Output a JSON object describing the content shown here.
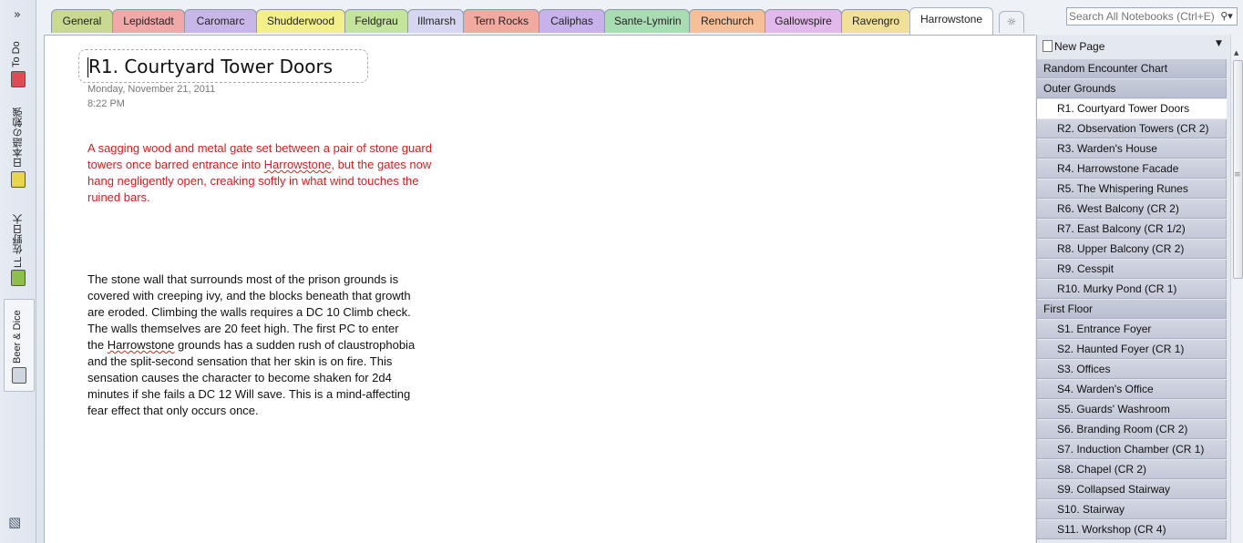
{
  "notebooks": [
    {
      "label": "To Do",
      "color": "#e04a54"
    },
    {
      "label": "日本語の勉強",
      "color": "#e9d54c"
    },
    {
      "label": "LL 佐野日大",
      "color": "#8cc04b"
    },
    {
      "label": "Beer & Dice",
      "color": "#cfd6df"
    }
  ],
  "search": {
    "placeholder": "Search All Notebooks (Ctrl+E)"
  },
  "tabs": [
    {
      "label": "General",
      "color": "#c9d98f"
    },
    {
      "label": "Lepidstadt",
      "color": "#f0a8a8"
    },
    {
      "label": "Caromarc",
      "color": "#c9b6e8"
    },
    {
      "label": "Shudderwood",
      "color": "#f3f08c"
    },
    {
      "label": "Feldgrau",
      "color": "#c4e39b"
    },
    {
      "label": "Illmarsh",
      "color": "#d6d6f0"
    },
    {
      "label": "Tern Rocks",
      "color": "#f2a9a0"
    },
    {
      "label": "Caliphas",
      "color": "#c7b3ea"
    },
    {
      "label": "Sante-Lymirin",
      "color": "#a9dcb2"
    },
    {
      "label": "Renchurch",
      "color": "#f7bf98"
    },
    {
      "label": "Gallowspire",
      "color": "#e2b9ea"
    },
    {
      "label": "Ravengro",
      "color": "#f1e198"
    },
    {
      "label": "Harrowstone",
      "color": "#ffffff"
    }
  ],
  "page": {
    "title": "R1. Courtyard Tower Doors",
    "date": "Monday, November  21, 2011",
    "time": "8:22 PM",
    "note1_a": "A sagging wood and metal gate set between a pair of stone guard towers once barred entrance into ",
    "note1_link": "Harrowstone",
    "note1_b": ", but the gates now hang negligently open, creaking softly in what wind touches the ruined bars.",
    "note2_a": "The stone wall that surrounds most of the prison grounds is covered with creeping ivy, and the blocks beneath that growth are eroded. Climbing the walls requires a DC 10 Climb check. The walls themselves are 20 feet high. The first PC to enter the ",
    "note2_link": "Harrowstone",
    "note2_b": " grounds has a sudden rush of claustrophobia and the split-second sensation that her skin is on fire. This sensation causes the character to become shaken for 2d4 minutes if she fails a DC 12 Will save. This is a mind-affecting fear effect that only occurs once."
  },
  "pane": {
    "new_page": "New Page",
    "pages": [
      {
        "label": "Random Encounter Chart",
        "kind": "sec"
      },
      {
        "label": "Outer Grounds",
        "kind": "sec"
      },
      {
        "label": "R1. Courtyard Tower Doors",
        "kind": "sel"
      },
      {
        "label": "R2. Observation Towers (CR 2)",
        "kind": "sub"
      },
      {
        "label": "R3. Warden's House",
        "kind": "sub"
      },
      {
        "label": "R4. Harrowstone Facade",
        "kind": "sub"
      },
      {
        "label": "R5. The Whispering Runes",
        "kind": "sub"
      },
      {
        "label": "R6. West Balcony (CR 2)",
        "kind": "sub"
      },
      {
        "label": "R7. East Balcony (CR 1/2)",
        "kind": "sub"
      },
      {
        "label": "R8. Upper Balcony (CR 2)",
        "kind": "sub"
      },
      {
        "label": "R9. Cesspit",
        "kind": "sub"
      },
      {
        "label": "R10. Murky Pond (CR 1)",
        "kind": "sub"
      },
      {
        "label": "First Floor",
        "kind": "sec"
      },
      {
        "label": "S1. Entrance Foyer",
        "kind": "sub"
      },
      {
        "label": "S2. Haunted Foyer (CR 1)",
        "kind": "sub"
      },
      {
        "label": "S3. Offices",
        "kind": "sub"
      },
      {
        "label": "S4. Warden's Office",
        "kind": "sub"
      },
      {
        "label": "S5. Guards' Washroom",
        "kind": "sub"
      },
      {
        "label": "S6. Branding Room (CR 2)",
        "kind": "sub"
      },
      {
        "label": "S7. Induction Chamber (CR 1)",
        "kind": "sub"
      },
      {
        "label": "S8. Chapel (CR 2)",
        "kind": "sub"
      },
      {
        "label": "S9. Collapsed Stairway",
        "kind": "sub"
      },
      {
        "label": "S10. Stairway",
        "kind": "sub"
      },
      {
        "label": "S11. Workshop (CR 4)",
        "kind": "sub"
      }
    ]
  }
}
